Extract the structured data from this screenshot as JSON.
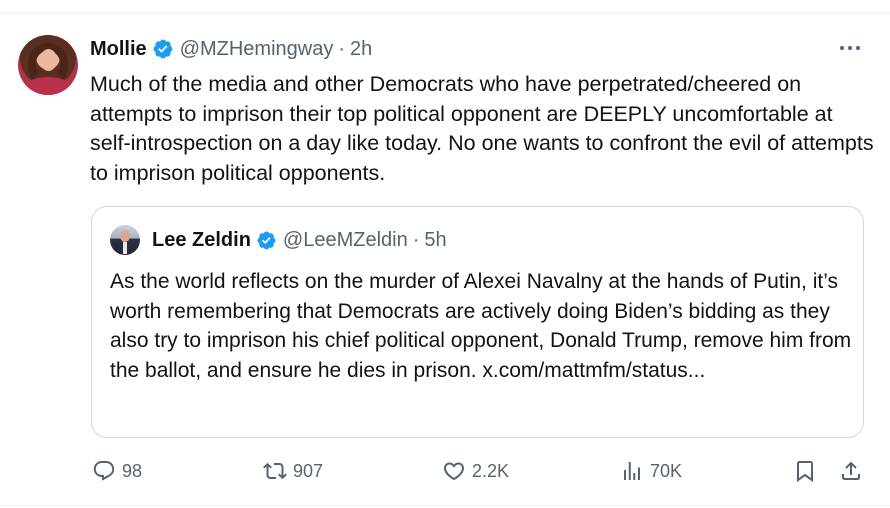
{
  "author": {
    "display_name": "Mollie",
    "handle": "@MZHemingway",
    "separator": "·",
    "time": "2h",
    "verified_color": "#1d9bf0"
  },
  "tweet": {
    "text": "Much of the media and other Democrats who have perpetrated/cheered on attempts to imprison their top political opponent are DEEPLY uncomfortable at self-introspection on a day like today. No one wants to confront the evil of attempts to imprison political opponents."
  },
  "quote": {
    "display_name": "Lee Zeldin",
    "handle": "@LeeMZeldin",
    "separator": "·",
    "time": "5h",
    "text": "As the world reflects on the murder of Alexei Navalny at the hands of Putin, it’s worth remembering that Democrats are actively doing Biden’s bidding as they also try to imprison his chief political opponent, Donald Trump, remove him from the ballot, and ensure he dies in prison. x.com/mattmfm/status..."
  },
  "actions": {
    "replies": "98",
    "reposts": "907",
    "likes": "2.2K",
    "views": "70K",
    "icons": [
      "reply-icon",
      "repost-icon",
      "like-icon",
      "views-icon",
      "bookmark-icon",
      "share-icon"
    ]
  },
  "colors": {
    "text": "#0f1419",
    "secondary": "#536471",
    "border": "#cfd9de",
    "verified": "#1d9bf0"
  }
}
